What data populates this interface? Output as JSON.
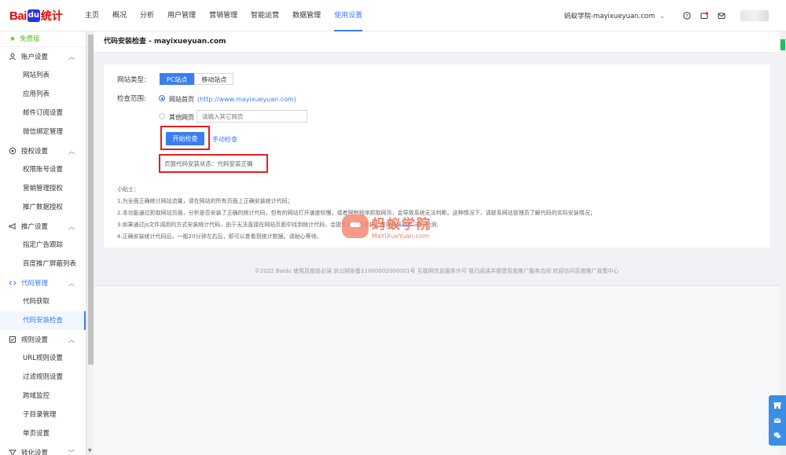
{
  "brand": {
    "part1": "Bai",
    "paw": "du",
    "part2": "统计"
  },
  "nav": [
    {
      "label": "主页",
      "active": false
    },
    {
      "label": "概况",
      "active": false
    },
    {
      "label": "分析",
      "active": false
    },
    {
      "label": "用户管理",
      "active": false
    },
    {
      "label": "营销管理",
      "active": false
    },
    {
      "label": "智能运营",
      "active": false
    },
    {
      "label": "数据管理",
      "active": false
    },
    {
      "label": "使用设置",
      "active": true
    }
  ],
  "header_right": {
    "site_name": "蚂蚁学院-mayixueyuan.com",
    "icons": [
      "help-icon",
      "message-icon",
      "mail-icon"
    ]
  },
  "sidebar": {
    "free_label": "免费版",
    "groups": [
      {
        "label": "账户设置",
        "icon": "user-icon",
        "items": [
          "网站列表",
          "应用列表",
          "邮件订阅设置",
          "微信绑定管理"
        ]
      },
      {
        "label": "授权设置",
        "icon": "auth-icon",
        "items": [
          "权限账号设置",
          "营销管理授权",
          "推广数据授权"
        ]
      },
      {
        "label": "推广设置",
        "icon": "megaphone-icon",
        "items": [
          "指定广告跟踪",
          "百度推广屏蔽列表"
        ]
      },
      {
        "label": "代码管理",
        "icon": "code-icon",
        "items": [
          "代码获取",
          "代码安装检查"
        ]
      },
      {
        "label": "规则设置",
        "icon": "rule-icon",
        "items": [
          "URL规则设置",
          "过滤规则设置",
          "跨域监控",
          "子目录管理",
          "单页设置"
        ]
      },
      {
        "label": "转化设置",
        "icon": "convert-icon",
        "items": []
      }
    ],
    "active_group": "代码管理",
    "active_item": "代码安装检查"
  },
  "page": {
    "title": "代码安装检查 - mayixueyuan.com",
    "site_type_label": "网站类型:",
    "site_types": [
      "PC站点",
      "移动站点"
    ],
    "active_site_type": "PC站点",
    "scope_label": "检查范围:",
    "option_home_label": "网站首页",
    "option_home_url": "(http://www.mayixueyuan.com)",
    "option_other_label": "其他网页",
    "other_url_placeholder": "请输入其它网页",
    "start_button": "开始检查",
    "manual_link": "手动检查",
    "status_text": "页面代码安装状态：代码安装正确",
    "tips_title": "小贴士：",
    "tips": [
      "1.为全面正确统计网站流量，请在网站的所有页面上正确安装统计代码；",
      "2.本功能通过抓取网站页面，分析是否安装了正确的统计代码，但有的网站打开速度较慢，或者限制程序抓取网页，会导致系统无法判断。这种情况下，请联系网站管理员了解代码的实际安装情况；",
      "3.如果通过js文件调用的方式安装统计代码，由于无法直接在网站页面中找到统计代码，会提示未正确安装，建议安装",
      "4.正确安装统计代码后，一般20分钟左右后，即可以查看到统计数据。请耐心等待。"
    ],
    "tip3_link": "助手",
    "tip3_suffix": " 进行检测;"
  },
  "footer": "©2022 Baidu 使用百度前必读 京公网安备11000002000001号 互联网信息服务许可 我已阅读并接受百度推广服务合同 欢迎访问百度推广政策中心",
  "watermark": {
    "cn": "蚂蚁学院",
    "en": "MaYiXueYuan.com"
  },
  "colors": {
    "accent": "#3a7ef2",
    "highlight_box": "#e02020",
    "free": "#52c41a"
  }
}
